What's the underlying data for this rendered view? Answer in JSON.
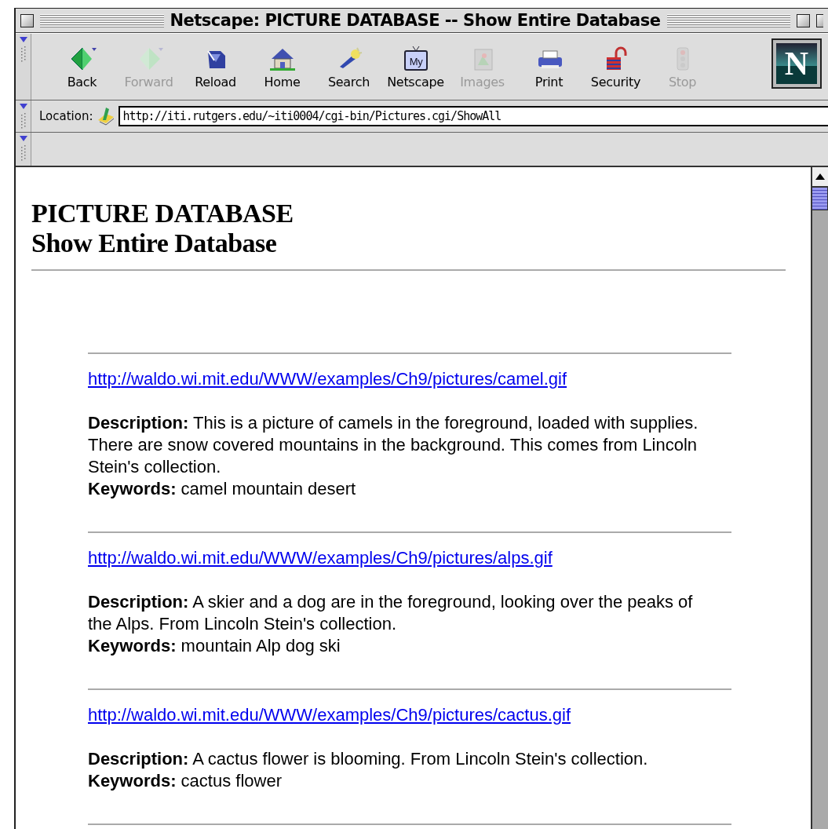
{
  "window": {
    "title": "Netscape: PICTURE DATABASE -- Show Entire Database"
  },
  "toolbar": [
    {
      "label": "Back",
      "disabled": false
    },
    {
      "label": "Forward",
      "disabled": true
    },
    {
      "label": "Reload",
      "disabled": false
    },
    {
      "label": "Home",
      "disabled": false
    },
    {
      "label": "Search",
      "disabled": false
    },
    {
      "label": "Netscape",
      "disabled": false
    },
    {
      "label": "Images",
      "disabled": true
    },
    {
      "label": "Print",
      "disabled": false
    },
    {
      "label": "Security",
      "disabled": false
    },
    {
      "label": "Stop",
      "disabled": true
    }
  ],
  "logo": {
    "text": "N"
  },
  "netscape_icon_text": "My",
  "location": {
    "label": "Location:",
    "value": "http://iti.rutgers.edu/~iti0004/cgi-bin/Pictures.cgi/ShowAll"
  },
  "page": {
    "heading": [
      "PICTURE DATABASE",
      "Show Entire Database"
    ],
    "entries": [
      {
        "link": "http://waldo.wi.mit.edu/WWW/examples/Ch9/pictures/camel.gif",
        "description": "**Description:** This is a picture of camels in the foreground, loaded with supplies. There are snow covered mountains in the background. This comes from Lincoln Stein's collection.",
        "keywords": "**Keywords:** camel mountain desert"
      },
      {
        "link": "http://waldo.wi.mit.edu/WWW/examples/Ch9/pictures/alps.gif",
        "description": "**Description:** A skier and a dog are in the foreground, looking over the peaks of the Alps. From Lincoln Stein's collection.",
        "keywords": "**Keywords:** mountain Alp dog ski"
      },
      {
        "link": "http://waldo.wi.mit.edu/WWW/examples/Ch9/pictures/cactus.gif",
        "description": "**Description:** A cactus flower is blooming. From Lincoln Stein's collection.",
        "keywords": "**Keywords:** cactus flower"
      }
    ]
  }
}
